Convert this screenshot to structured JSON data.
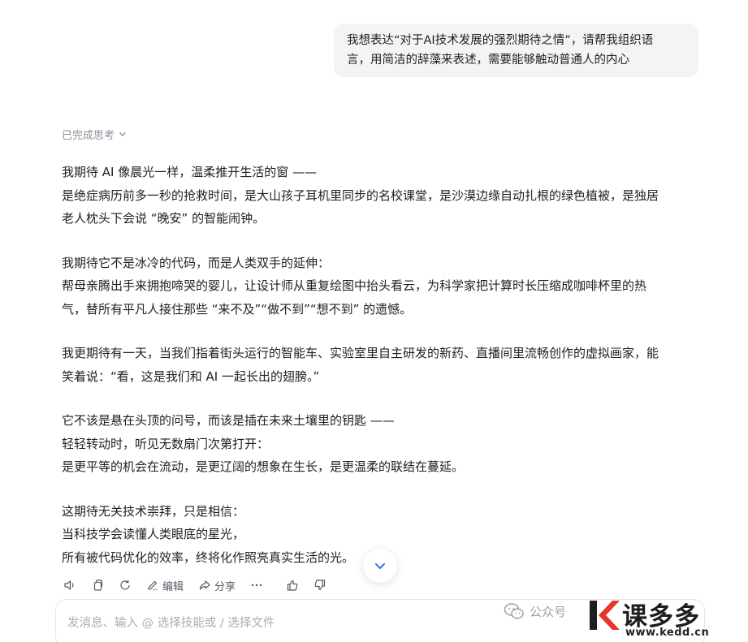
{
  "user_message": {
    "lines": [
      "我想表达“对于AI技术发展的强烈期待之情”，请帮我组织语",
      "言，用简洁的辞藻来表述，需要能够触动普通人的内心"
    ]
  },
  "thinking_toggle": {
    "label": "已完成思考",
    "icon": "chevron-down-icon"
  },
  "answer": {
    "paragraphs": [
      [
        "我期待 AI 像晨光一样，温柔推开生活的窗 ——",
        "是绝症病历前多一秒的抢救时间，是大山孩子耳机里同步的名校课堂，是沙漠边缘自动扎根的绿色植被，是独居",
        "老人枕头下会说 “晚安” 的智能闹钟。"
      ],
      [
        "我期待它不是冰冷的代码，而是人类双手的延伸：",
        "帮母亲腾出手来拥抱啼哭的婴儿，让设计师从重复绘图中抬头看云，为科学家把计算时长压缩成咖啡杯里的热",
        "气，替所有平凡人接住那些 “来不及”“做不到”“想不到” 的遗憾。"
      ],
      [
        "我更期待有一天，当我们指着街头运行的智能车、实验室里自主研发的新药、直播间里流畅创作的虚拟画家，能",
        "笑着说：“看，这是我们和 AI 一起长出的翅膀。”"
      ],
      [
        "它不该是悬在头顶的问号，而该是插在未来土壤里的钥匙 ——",
        "轻轻转动时，听见无数扇门次第打开：",
        "是更平等的机会在流动，是更辽阔的想象在生长，是更温柔的联结在蔓延。"
      ],
      [
        "这期待无关技术崇拜，只是相信：",
        "当科技学会读懂人类眼底的星光，",
        "所有被代码优化的效率，终将化作照亮真实生活的光。"
      ]
    ]
  },
  "actions": {
    "speak_icon": "speaker-icon",
    "copy_icon": "copy-icon",
    "regenerate_icon": "refresh-icon",
    "edit_label": "编辑",
    "share_label": "分享",
    "more_icon": "more-icon",
    "like_icon": "thumbs-up-icon",
    "dislike_icon": "thumbs-down-icon"
  },
  "composer": {
    "placeholder": "发消息、输入 @ 选择技能或 / 选择文件"
  },
  "watermark": {
    "wechat_text": "公众号",
    "brand": "课多多",
    "url": "www.kedd.cn"
  },
  "colors": {
    "bubble_bg": "#f3f4f6",
    "muted_text": "#8a8f99",
    "brand_red": "#e4362a"
  }
}
